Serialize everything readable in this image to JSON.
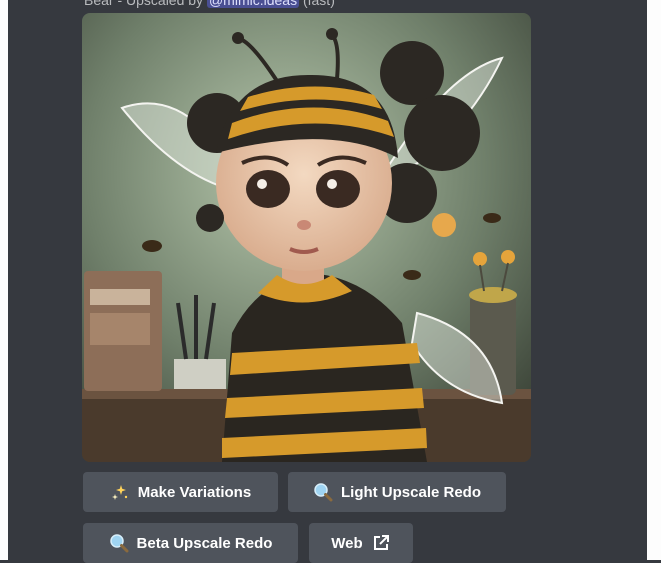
{
  "message": {
    "caption_prefix": "Bear - Upscaled by",
    "caption_mention": "@mimic.ideas",
    "caption_suffix": "(fast)"
  },
  "image": {
    "alt": "Bee girl character"
  },
  "buttons": {
    "make_variations": "Make Variations",
    "light_upscale_redo": "Light Upscale Redo",
    "beta_upscale_redo": "Beta Upscale Redo",
    "web": "Web"
  },
  "icons": {
    "make_variations": "sparkles-icon",
    "light_upscale_redo": "magnifier-icon",
    "beta_upscale_redo": "magnifier-icon",
    "web": "external-link-icon"
  },
  "colors": {
    "background": "#36393f",
    "button": "#4f545c",
    "mention_bg": "#4a4f93"
  }
}
